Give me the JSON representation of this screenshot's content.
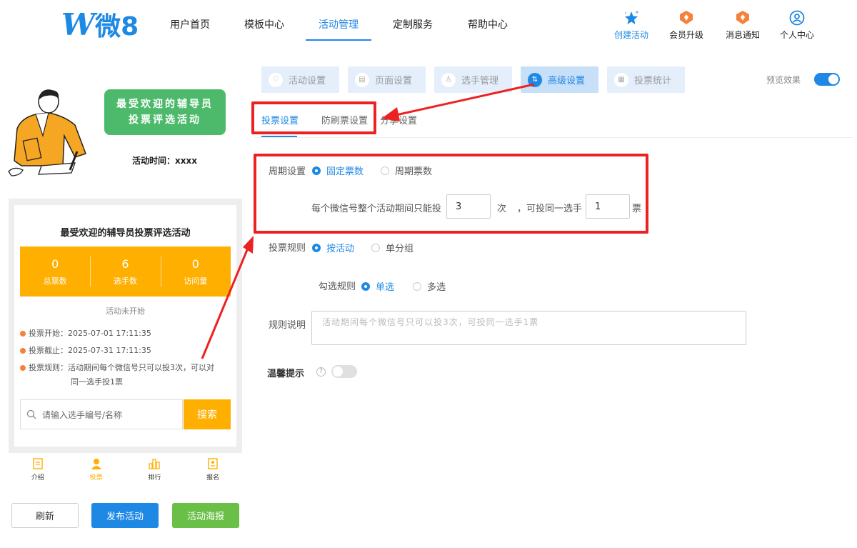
{
  "logo": {
    "letter": "W",
    "text": "微8"
  },
  "nav": {
    "items": [
      "用户首页",
      "模板中心",
      "活动管理",
      "定制服务",
      "帮助中心"
    ],
    "right": [
      "创建活动",
      "会员升级",
      "消息通知",
      "个人中心"
    ]
  },
  "preview": {
    "banner_line1": "最受欢迎的辅导员",
    "banner_line2": "投票评选活动",
    "time_label": "活动时间：xxxx",
    "card_title": "最受欢迎的辅导员投票评选活动",
    "stats": [
      {
        "num": "0",
        "label": "总票数"
      },
      {
        "num": "6",
        "label": "选手数"
      },
      {
        "num": "0",
        "label": "访问量"
      }
    ],
    "status": "活动未开始",
    "vote_start": "投票开始：2025-07-01 17:11:35",
    "vote_end": "投票截止：2025-07-31 17:11:35",
    "vote_rule_line1": "投票规则：活动期间每个微信号只可以投3次，可以对",
    "vote_rule_line2": "同一选手投1票",
    "search_placeholder": "请输入选手编号/名称",
    "search_button": "搜索",
    "tabbar": [
      "介绍",
      "投票",
      "排行",
      "报名"
    ]
  },
  "actions": {
    "refresh": "刷新",
    "publish": "发布活动",
    "poster": "活动海报"
  },
  "settings": {
    "tabs": [
      "活动设置",
      "页面设置",
      "选手管理",
      "高级设置",
      "投票统计"
    ],
    "preview_label": "预览效果",
    "subtabs": [
      "投票设置",
      "防刷票设置",
      "分享设置"
    ],
    "cycle_label": "周期设置",
    "cycle_options": [
      "固定票数",
      "周期票数"
    ],
    "per_user_prefix": "每个微信号整个活动期间只能投",
    "per_user_value": "3",
    "per_user_unit": "次",
    "same_player_text": "，可投同一选手",
    "same_player_value": "1",
    "same_player_unit": "票",
    "rule_label": "投票规则",
    "rule_options": [
      "按活动",
      "单分组"
    ],
    "check_label": "勾选规则",
    "check_options": [
      "单选",
      "多选"
    ],
    "desc_label": "规则说明",
    "desc_placeholder": "活动期间每个微信号只可以投3次，可投同一选手1票",
    "tip_label": "温馨提示"
  },
  "colors": {
    "accent": "#1e88e5",
    "orange": "#ffaf00",
    "green": "#4cba6a",
    "highlight": "#ec2121"
  }
}
